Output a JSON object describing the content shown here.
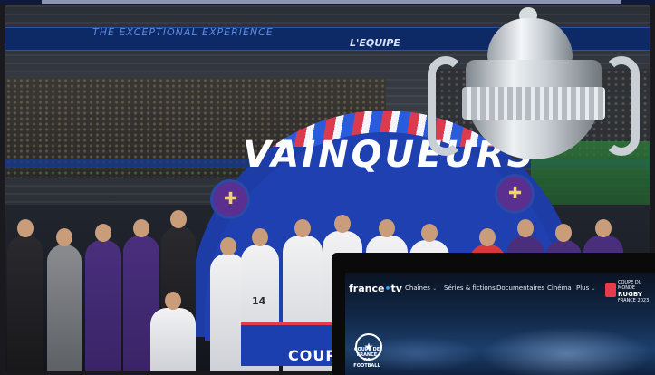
{
  "photo": {
    "board_left": "THE EXCEPTIONAL EXPERIENCE",
    "board_right": "L'EQUIPE",
    "banner_title": "VAINQUEURS",
    "banner_bottom": "COUPE",
    "jersey_number": "14"
  },
  "tv": {
    "brand": "france",
    "brand_suffix": "tv",
    "nav": [
      {
        "label": "Chaînes",
        "has_chevron": true
      },
      {
        "label": "Séries & fictions",
        "has_chevron": false
      },
      {
        "label": "Documentaires",
        "has_chevron": false
      },
      {
        "label": "Cinéma",
        "has_chevron": false
      },
      {
        "label": "Plus",
        "has_chevron": true
      }
    ],
    "rugby": {
      "line1": "COUPE DU MONDE",
      "line2": "RUGBY",
      "line3": "FRANCE 2023"
    },
    "coupe_logo": {
      "line1": "COUPE DE FRANCE",
      "line2": "DE FOOTBALL"
    }
  },
  "icons": {
    "chevron": "chevron-down-icon",
    "trophy": "trophy-icon"
  },
  "colors": {
    "accent_red": "#e63b4a",
    "banner_blue": "#1d3ca6",
    "tv_blue": "#2fa3ff",
    "toulouse_purple": "#4a2f7e"
  }
}
